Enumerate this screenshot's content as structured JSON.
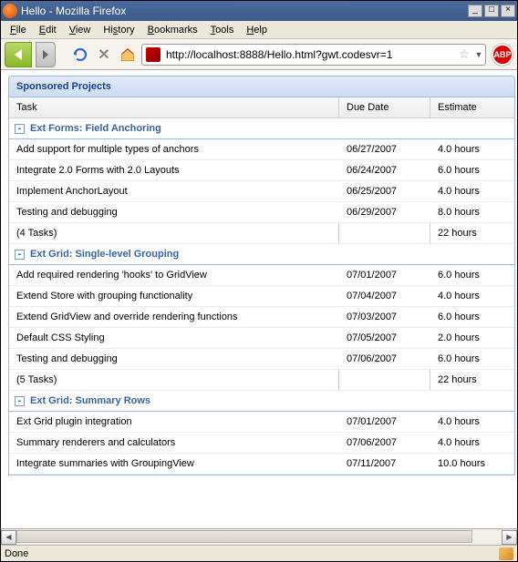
{
  "window": {
    "title": "Hello - Mozilla Firefox",
    "minimize": "_",
    "maximize": "□",
    "close": "×"
  },
  "menu": {
    "file": "File",
    "edit": "Edit",
    "view": "View",
    "history": "History",
    "bookmarks": "Bookmarks",
    "tools": "Tools",
    "help": "Help"
  },
  "toolbar": {
    "url": "http://localhost:8888/Hello.html?gwt.codesvr=1",
    "abp": "ABP"
  },
  "panel": {
    "title": "Sponsored Projects"
  },
  "columns": {
    "task": "Task",
    "due": "Due Date",
    "est": "Estimate"
  },
  "groups": [
    {
      "title": "Ext Forms: Field Anchoring",
      "rows": [
        {
          "task": "Add support for multiple types of anchors",
          "due": "06/27/2007",
          "est": "4.0 hours"
        },
        {
          "task": "Integrate 2.0 Forms with 2.0 Layouts",
          "due": "06/24/2007",
          "est": "6.0 hours"
        },
        {
          "task": "Implement AnchorLayout",
          "due": "06/25/2007",
          "est": "4.0 hours"
        },
        {
          "task": "Testing and debugging",
          "due": "06/29/2007",
          "est": "8.0 hours"
        }
      ],
      "summary": {
        "task": "(4 Tasks)",
        "due": "",
        "est": "22 hours"
      }
    },
    {
      "title": "Ext Grid: Single-level Grouping",
      "rows": [
        {
          "task": "Add required rendering 'hooks' to GridView",
          "due": "07/01/2007",
          "est": "6.0 hours"
        },
        {
          "task": "Extend Store with grouping functionality",
          "due": "07/04/2007",
          "est": "4.0 hours"
        },
        {
          "task": "Extend GridView and override rendering functions",
          "due": "07/03/2007",
          "est": "6.0 hours"
        },
        {
          "task": "Default CSS Styling",
          "due": "07/05/2007",
          "est": "2.0 hours"
        },
        {
          "task": "Testing and debugging",
          "due": "07/06/2007",
          "est": "6.0 hours"
        }
      ],
      "summary": {
        "task": "(5 Tasks)",
        "due": "",
        "est": "22 hours"
      }
    },
    {
      "title": "Ext Grid: Summary Rows",
      "rows": [
        {
          "task": "Ext Grid plugin integration",
          "due": "07/01/2007",
          "est": "4.0 hours"
        },
        {
          "task": "Summary renderers and calculators",
          "due": "07/06/2007",
          "est": "4.0 hours"
        },
        {
          "task": "Integrate summaries with GroupingView",
          "due": "07/11/2007",
          "est": "10.0 hours"
        }
      ],
      "summary": null
    }
  ],
  "status": {
    "text": "Done"
  }
}
